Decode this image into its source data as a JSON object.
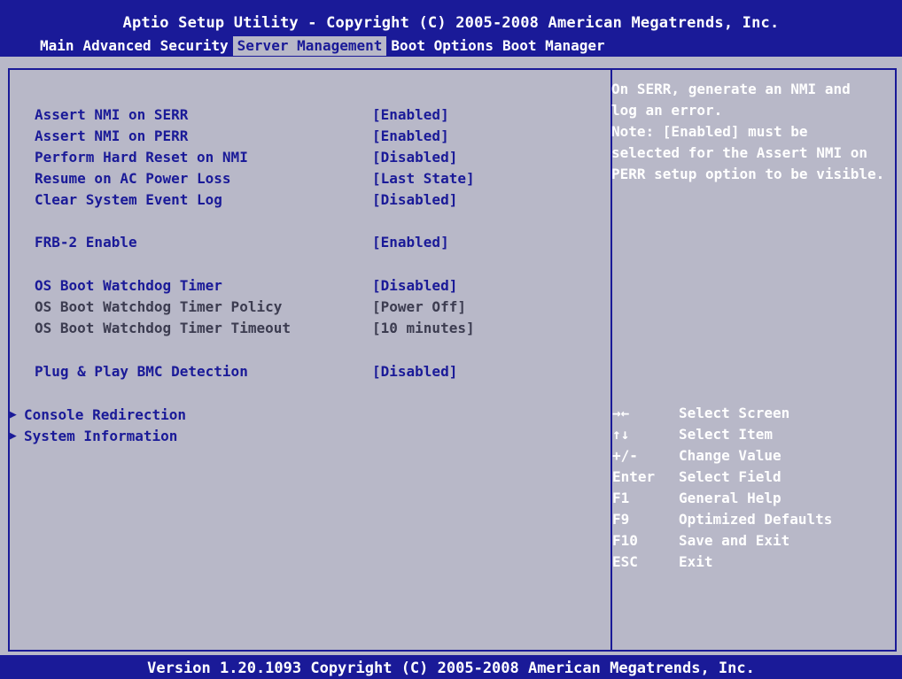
{
  "header": {
    "title": "Aptio Setup Utility - Copyright (C) 2005-2008 American Megatrends, Inc.",
    "tabs": [
      "Main",
      "Advanced",
      "Security",
      "Server Management",
      "Boot Options",
      "Boot Manager"
    ],
    "active_tab": "Server Management"
  },
  "settings": [
    {
      "label": "Assert NMI on SERR",
      "value": "[Enabled]"
    },
    {
      "label": "Assert NMI on PERR",
      "value": "[Enabled]"
    },
    {
      "label": "Perform Hard Reset on NMI",
      "value": "[Disabled]"
    },
    {
      "label": "Resume on AC Power Loss",
      "value": "[Last State]"
    },
    {
      "label": "Clear System Event Log",
      "value": "[Disabled]"
    },
    {
      "label": "FRB-2 Enable",
      "value": "[Enabled]"
    },
    {
      "label": "OS Boot Watchdog Timer",
      "value": "[Disabled]"
    },
    {
      "label": "OS Boot Watchdog Timer Policy",
      "value": "[Power Off]"
    },
    {
      "label": "OS Boot Watchdog Timer Timeout",
      "value": "[10 minutes]"
    },
    {
      "label": "Plug & Play BMC Detection",
      "value": "[Disabled]"
    }
  ],
  "submenus": [
    {
      "arrow": "▶",
      "label": "Console Redirection"
    },
    {
      "arrow": "▶",
      "label": "System Information"
    }
  ],
  "help": {
    "lines": [
      "On SERR, generate an NMI and",
      "log an error.",
      "Note: [Enabled] must be",
      "selected for the Assert NMI on",
      "PERR setup option to be visible."
    ]
  },
  "keys": [
    {
      "key": "→←",
      "desc": "Select Screen"
    },
    {
      "key": "↑↓",
      "desc": "Select Item"
    },
    {
      "key": "+/-",
      "desc": "Change Value"
    },
    {
      "key": "Enter",
      "desc": "Select Field"
    },
    {
      "key": "F1",
      "desc": "General Help"
    },
    {
      "key": "F9",
      "desc": "Optimized Defaults"
    },
    {
      "key": "F10",
      "desc": "Save and Exit"
    },
    {
      "key": "ESC",
      "desc": "Exit"
    }
  ],
  "footer": {
    "text": "Version 1.20.1093 Copyright (C) 2005-2008 American Megatrends, Inc."
  },
  "colors": {
    "bios_blue": "#1a1a98",
    "panel_gray": "#b8b8c8",
    "text_white": "#ffffff",
    "disabled_text": "#3c3c50"
  }
}
